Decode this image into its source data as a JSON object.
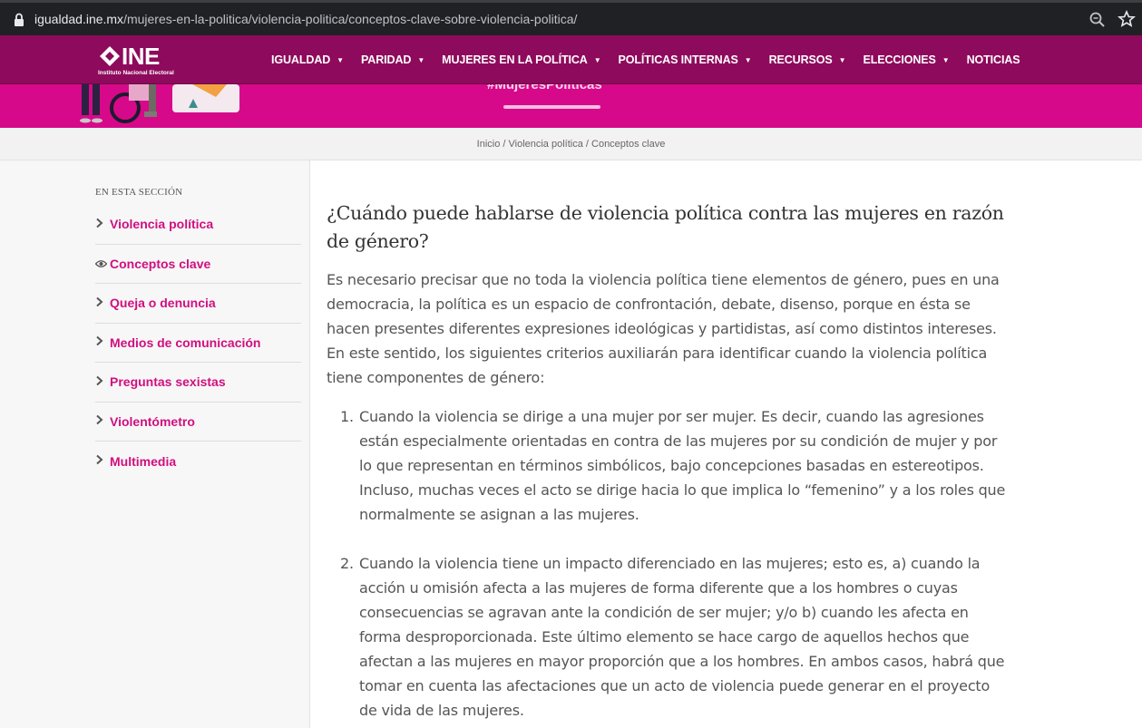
{
  "browser": {
    "url_host": "igualdad.ine.mx",
    "url_path": "/mujeres-en-la-politica/violencia-politica/conceptos-clave-sobre-violencia-politica/",
    "icons": [
      "lock-icon",
      "zoom-icon",
      "star-icon"
    ]
  },
  "nav": {
    "logo_text": "INE",
    "logo_sub": "Instituto Nacional Electoral",
    "items": [
      {
        "label": "IGUALDAD",
        "has_caret": true
      },
      {
        "label": "PARIDAD",
        "has_caret": true
      },
      {
        "label": "MUJERES EN LA POLÍTICA",
        "has_caret": true
      },
      {
        "label": "POLÍTICAS INTERNAS",
        "has_caret": true
      },
      {
        "label": "RECURSOS",
        "has_caret": true
      },
      {
        "label": "ELECCIONES",
        "has_caret": true
      },
      {
        "label": "NOTICIAS",
        "has_caret": false
      }
    ],
    "caret": "▼"
  },
  "hero": {
    "title": "#MujeresPolíticas"
  },
  "breadcrumb": {
    "text": "Inicio / Violencia política / Conceptos clave"
  },
  "sidebar": {
    "heading": "EN ESTA SECCIÓN",
    "items": [
      {
        "label": "Violencia política",
        "icon": "chevron-right-icon"
      },
      {
        "label": "Conceptos clave",
        "icon": "eye-icon"
      },
      {
        "label": "Queja o denuncia",
        "icon": "chevron-right-icon"
      },
      {
        "label": "Medios de comunicación",
        "icon": "chevron-right-icon"
      },
      {
        "label": "Preguntas sexistas",
        "icon": "chevron-right-icon"
      },
      {
        "label": "Violentómetro",
        "icon": "chevron-right-icon"
      },
      {
        "label": "Multimedia",
        "icon": "chevron-right-icon"
      }
    ]
  },
  "content": {
    "title": "¿Cuándo puede hablarse de violencia política contra las mujeres en razón de género?",
    "intro": "Es necesario precisar que no toda la violencia política tiene elementos de género, pues en una democracia, la política es un espacio de confrontación, debate, disenso, porque en ésta se hacen presentes diferentes expresiones ideológicas y partidistas, así como distintos intereses. En este sentido, los siguientes criterios auxiliarán para identificar cuando la violencia política tiene componentes de género:",
    "criteria": [
      {
        "num": "1.",
        "text": "Cuando la violencia se dirige a una mujer por ser mujer. Es decir, cuando las agresiones están especialmente orientadas en contra de las mujeres por su condición de mujer y por lo que representan en términos simbólicos, bajo concepciones basadas en estereotipos. Incluso, muchas veces el acto se dirige hacia lo que implica lo “femenino” y a los roles que normalmente se asignan a las mujeres."
      },
      {
        "num": "2.",
        "text": "Cuando la violencia tiene un impacto diferenciado en las mujeres; esto es, a) cuando la acción u omisión afecta a las mujeres de forma diferente que a los hombres o cuyas consecuencias se agravan ante la condición de ser mujer; y/o b) cuando les afecta en forma desproporcionada. Este último elemento se hace cargo de aquellos hechos que afectan a las mujeres en mayor proporción que a los hombres. En ambos casos, habrá que tomar en cuenta las afectaciones que un acto de violencia puede generar en el proyecto de vida de las mujeres."
      }
    ]
  },
  "colors": {
    "nav_bg": "#8e0a5c",
    "hero_bg": "#d6098a",
    "link": "#d10f80"
  }
}
